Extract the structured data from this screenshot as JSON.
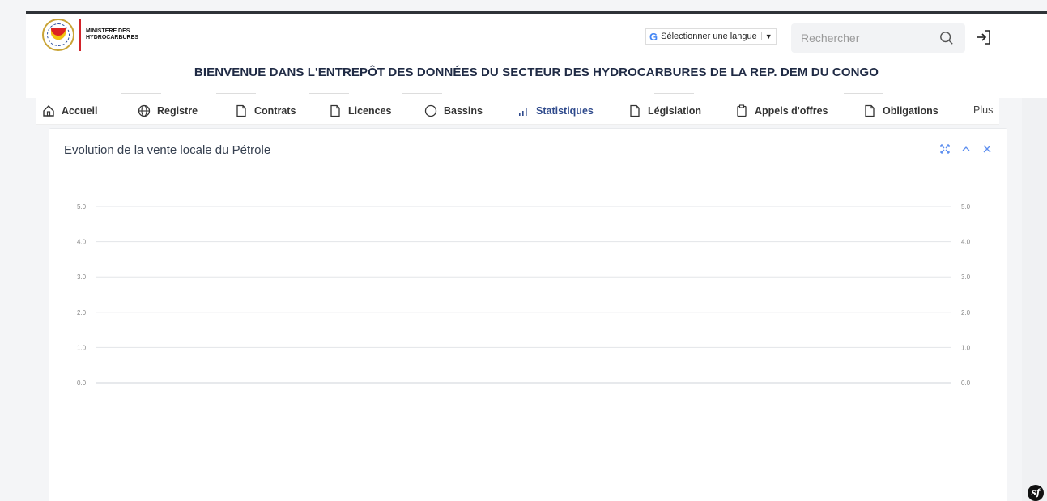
{
  "header": {
    "ministry_line1": "MINISTERE DES",
    "ministry_line2": "HYDROCARBURES",
    "lang_label": "Sélectionner une langue",
    "lang_caret": "▼",
    "search_placeholder": "Rechercher",
    "site_title": "BIENVENUE DANS L'ENTREPÔT DES DONNÉES DU SECTEUR DES HYDROCARBURES DE LA REP. DEM DU CONGO"
  },
  "nav": {
    "items": [
      {
        "label": "Accueil",
        "icon": "home-icon"
      },
      {
        "label": "Registre",
        "icon": "globe-icon"
      },
      {
        "label": "Contrats",
        "icon": "file-icon"
      },
      {
        "label": "Licences",
        "icon": "file-icon"
      },
      {
        "label": "Bassins",
        "icon": "circle-icon"
      },
      {
        "label": "Statistiques",
        "icon": "bar-chart-icon",
        "active": true
      },
      {
        "label": "Législation",
        "icon": "file-icon"
      },
      {
        "label": "Appels d'offres",
        "icon": "clipboard-icon"
      },
      {
        "label": "Obligations",
        "icon": "file-icon"
      },
      {
        "label": "Plus",
        "icon": ""
      }
    ]
  },
  "panel": {
    "title": "Evolution de la vente locale du Pétrole"
  },
  "chart_data": {
    "type": "line",
    "title": "Evolution de la vente locale du Pétrole",
    "y_ticks_left": [
      "5.0",
      "4.0",
      "3.0",
      "2.0",
      "1.0",
      "0.0"
    ],
    "y_ticks_right": [
      "5.0",
      "4.0",
      "3.0",
      "2.0",
      "1.0",
      "0.0"
    ],
    "ylim": [
      0,
      5
    ],
    "series": [],
    "grid": true
  },
  "colors": {
    "accent": "#2f4a8c",
    "title": "#1f2a44",
    "control_blue": "#5b8def"
  }
}
